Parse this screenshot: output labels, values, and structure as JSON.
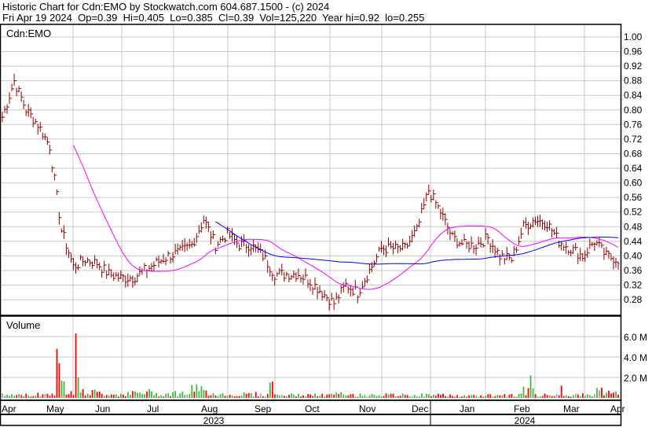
{
  "header": {
    "title": "Historic Chart for Cdn:EMO by Stockwatch.com 604.687.1500 - (c) 2024",
    "quote": "Fri Apr 19 2024  Op=0.39  Hi=0.405  Lo=0.385  Cl=0.39  Vol=125,220  Year hi=0.92  lo=0.255"
  },
  "chart_data": {
    "type": "line",
    "symbol": "Cdn:EMO",
    "volume_label": "Volume",
    "ylim": [
      0.24,
      1.02
    ],
    "yticks": [
      "1.00",
      "0.96",
      "0.92",
      "0.88",
      "0.84",
      "0.80",
      "0.76",
      "0.72",
      "0.68",
      "0.64",
      "0.60",
      "0.56",
      "0.52",
      "0.48",
      "0.44",
      "0.40",
      "0.36",
      "0.32",
      "0.28"
    ],
    "vol_ticks": [
      "6.0 M",
      "4.0 M",
      "2.0 M"
    ],
    "months": [
      "Apr",
      "May",
      "Jun",
      "Jul",
      "Aug",
      "Sep",
      "Oct",
      "Nov",
      "Dec",
      "Jan",
      "Feb",
      "Mar",
      "Apr"
    ],
    "years": [
      "2023",
      "2024"
    ],
    "weekly_close": [
      0.78,
      0.88,
      0.8,
      0.76,
      0.7,
      0.47,
      0.37,
      0.39,
      0.38,
      0.35,
      0.34,
      0.34,
      0.36,
      0.38,
      0.4,
      0.41,
      0.43,
      0.5,
      0.43,
      0.46,
      0.43,
      0.43,
      0.4,
      0.35,
      0.35,
      0.35,
      0.33,
      0.3,
      0.27,
      0.32,
      0.3,
      0.36,
      0.42,
      0.42,
      0.42,
      0.47,
      0.58,
      0.52,
      0.45,
      0.43,
      0.43,
      0.45,
      0.4,
      0.39,
      0.48,
      0.5,
      0.49,
      0.44,
      0.42,
      0.4,
      0.44,
      0.4,
      0.39
    ],
    "weekly_volume_m": [
      0.3,
      0.3,
      0.3,
      0.4,
      0.5,
      1.0,
      0.6,
      0.6,
      0.5,
      0.4,
      0.4,
      0.5,
      0.6,
      0.4,
      0.5,
      0.5,
      0.9,
      0.6,
      0.4,
      0.3,
      0.4,
      0.4,
      0.3,
      0.3,
      0.3,
      0.3,
      0.3,
      0.3,
      0.4,
      0.3,
      0.3,
      0.4,
      0.3,
      0.3,
      0.3,
      0.3,
      0.3,
      0.3,
      0.2,
      0.2,
      0.2,
      0.3,
      0.3,
      0.3,
      0.8,
      0.3,
      0.3,
      0.4,
      0.3,
      0.3,
      0.8,
      0.5,
      0.4
    ],
    "volume_spikes": [
      [
        23,
        4.8,
        "red"
      ],
      [
        24,
        3.4,
        "red"
      ],
      [
        25,
        1.7,
        "green"
      ],
      [
        26,
        1.6,
        "green"
      ],
      [
        31,
        6.3,
        "red"
      ],
      [
        32,
        2.0,
        "green"
      ],
      [
        113,
        1.5,
        "green"
      ],
      [
        114,
        1.6,
        "red"
      ],
      [
        223,
        2.2,
        "green"
      ],
      [
        236,
        1.2,
        "red"
      ],
      [
        262,
        1.6,
        "green"
      ],
      [
        266,
        1.2,
        "red"
      ],
      [
        267,
        1.1,
        "red"
      ]
    ],
    "moving_averages": [
      {
        "window": 30,
        "color": "#ff00ff"
      },
      {
        "window": 90,
        "color": "#0000ff"
      }
    ],
    "colors": {
      "bar": "#8b0000",
      "up": "#3cb83c",
      "down": "#ff0000",
      "flat": "#a0a0a0",
      "grid": "#c8c8c8"
    }
  }
}
